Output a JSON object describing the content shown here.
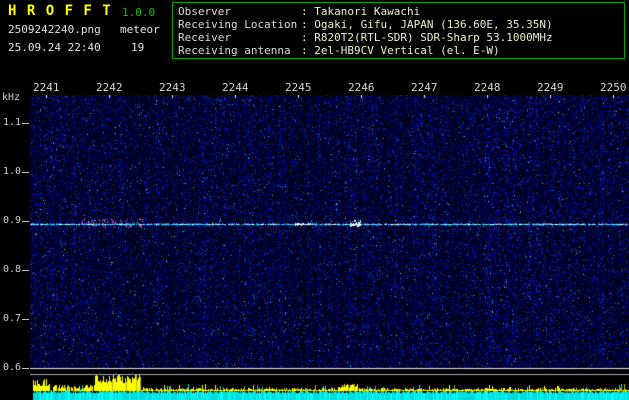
{
  "titlebar": {
    "app_name": "H R O F F T",
    "version": "1.0.0",
    "filename": "2509242240.png",
    "mode": "meteor",
    "timestamp": "25.09.24 22:40",
    "echo_count": "19"
  },
  "station_info": {
    "rows": [
      {
        "label": "Observer",
        "value": ": Takanori Kawachi"
      },
      {
        "label": "Receiving Location",
        "value": ": Ogaki, Gifu, JAPAN (136.60E, 35.35N)"
      },
      {
        "label": "Receiver",
        "value": ": R820T2(RTL-SDR) SDR-Sharp 53.1000MHz"
      },
      {
        "label": "Receiving antenna",
        "value": ": 2el-HB9CV Vertical (el. E-W)"
      }
    ]
  },
  "spectrogram": {
    "y_axis_unit": "kHz",
    "y_ticks": [
      "1.1",
      "1.0",
      "0.9",
      "0.8",
      "0.7",
      "0.6"
    ],
    "x_ticks": [
      "2241",
      "2242",
      "2243",
      "2244",
      "2245",
      "2246",
      "2247",
      "2248",
      "2249",
      "2250"
    ],
    "carrier_khz": "0.9"
  },
  "colors": {
    "title": "#ffff00",
    "version": "#00cc00",
    "box_border": "#00a000",
    "label_text": "#dcdcdc",
    "value_text": "#eeeecd",
    "carrier": "#3cd2ff",
    "echo": "#ff55ff",
    "signal_bar": "#ffff00",
    "noise_bar": "#00dcdc"
  }
}
